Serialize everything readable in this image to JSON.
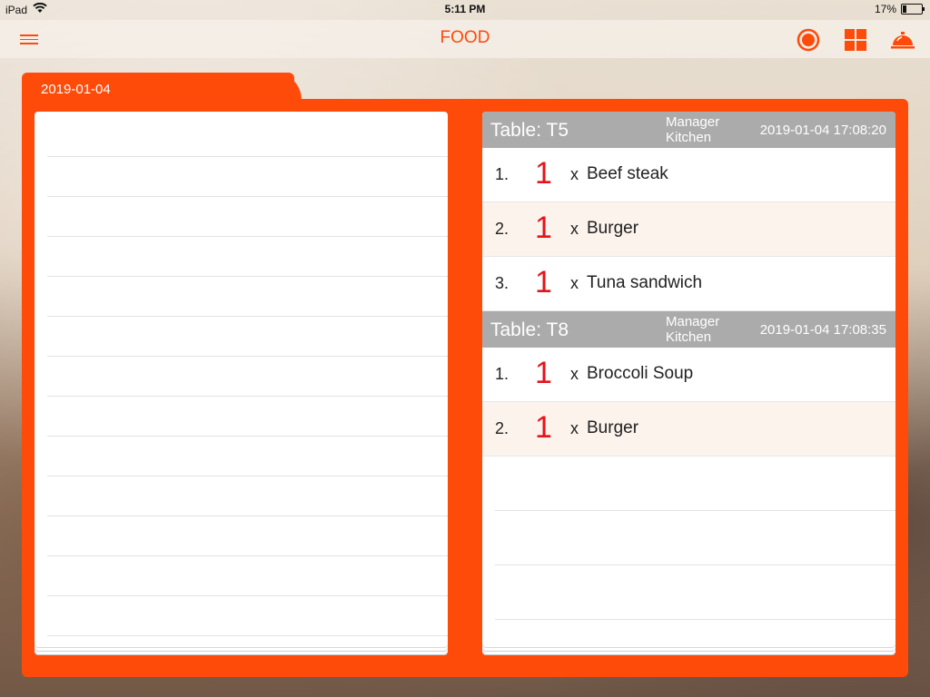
{
  "status": {
    "device": "iPad",
    "time": "5:11 PM",
    "battery": "17%"
  },
  "nav": {
    "title": "FOOD"
  },
  "folder": {
    "date": "2019-01-04"
  },
  "tickets": [
    {
      "table": "Table: T5",
      "role1": "Manager",
      "role2": "Kitchen",
      "time": "2019-01-04 17:08:20",
      "items": [
        {
          "num": "1.",
          "qty": "1",
          "x": "x",
          "name": "Beef steak"
        },
        {
          "num": "2.",
          "qty": "1",
          "x": "x",
          "name": "Burger"
        },
        {
          "num": "3.",
          "qty": "1",
          "x": "x",
          "name": "Tuna sandwich"
        }
      ]
    },
    {
      "table": "Table: T8",
      "role1": "Manager",
      "role2": "Kitchen",
      "time": "2019-01-04 17:08:35",
      "items": [
        {
          "num": "1.",
          "qty": "1",
          "x": "x",
          "name": "Broccoli Soup"
        },
        {
          "num": "2.",
          "qty": "1",
          "x": "x",
          "name": "Burger"
        }
      ]
    }
  ],
  "colors": {
    "accent": "#ff4b0a",
    "qty": "#e4141a",
    "header": "#ababab"
  },
  "icons": [
    "menu-icon",
    "wifi-icon",
    "record-icon",
    "grid-icon",
    "service-bell-icon"
  ]
}
